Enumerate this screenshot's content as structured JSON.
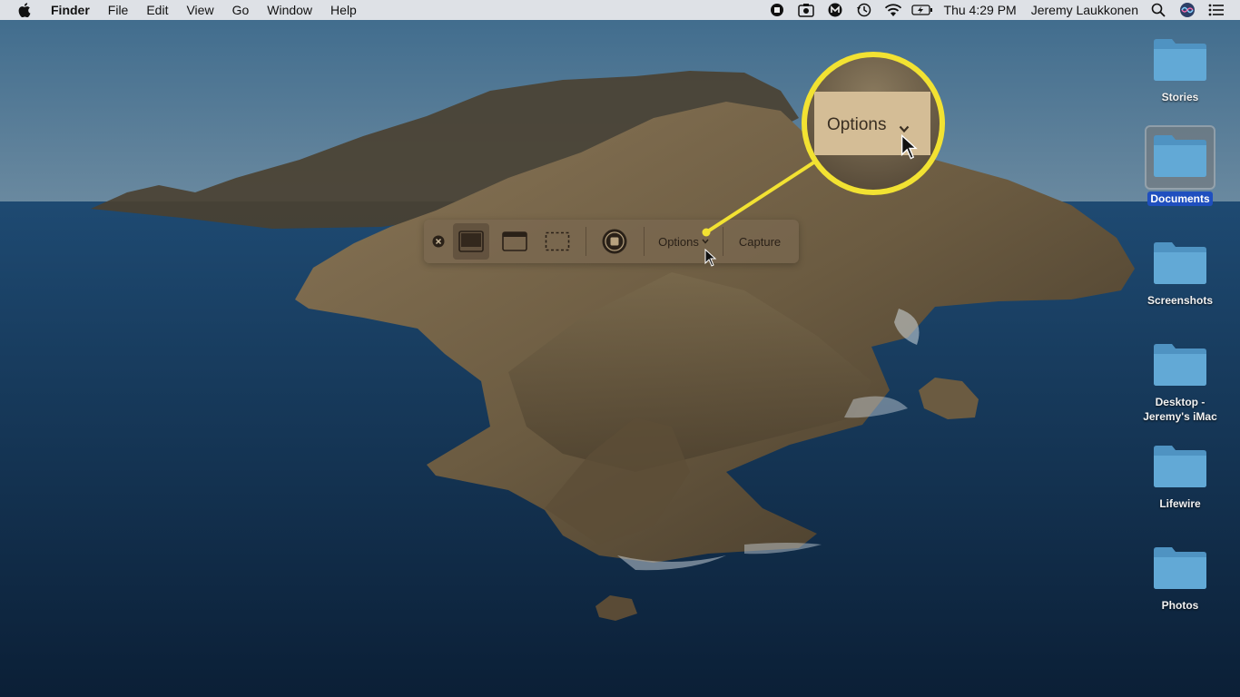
{
  "menubar": {
    "app_name": "Finder",
    "menus": [
      "File",
      "Edit",
      "View",
      "Go",
      "Window",
      "Help"
    ],
    "status_icons": [
      "stop-record-icon",
      "screenshot-app-icon",
      "malwarebytes-icon",
      "time-machine-icon",
      "wifi-icon",
      "battery-charging-icon"
    ],
    "clock": "Thu 4:29 PM",
    "user": "Jeremy Laukkonen"
  },
  "toolbar": {
    "options_label": "Options",
    "capture_label": "Capture"
  },
  "magnifier": {
    "label": "Options"
  },
  "desktop_items": [
    {
      "label": "Stories",
      "selected": false
    },
    {
      "label": "Documents",
      "selected": true
    },
    {
      "label": "Screenshots",
      "selected": false
    },
    {
      "label_line1": "Desktop -",
      "label_line2": "Jeremy's iMac",
      "selected": false
    },
    {
      "label": "Lifewire",
      "selected": false
    },
    {
      "label": "Photos",
      "selected": false
    }
  ],
  "colors": {
    "callout": "#f2e232",
    "selection": "#1f4fbf",
    "folder": "#62a9d6"
  }
}
